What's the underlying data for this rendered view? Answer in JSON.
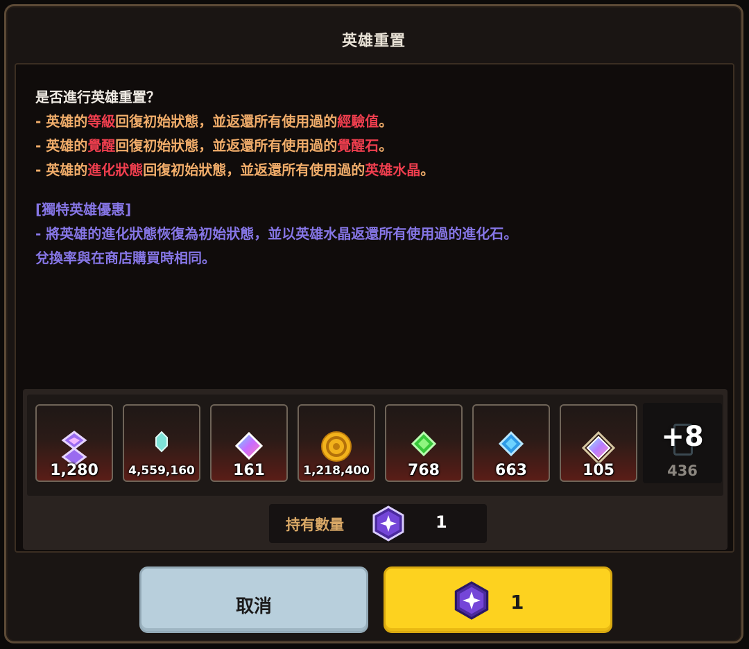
{
  "dialog": {
    "title": "英雄重置"
  },
  "description": {
    "question": "是否進行英雄重置？",
    "lines": [
      [
        {
          "t": "- 英雄的",
          "c": "o"
        },
        {
          "t": "等級",
          "c": "r"
        },
        {
          "t": "回復初始狀態，並返還所有使用過的",
          "c": "o"
        },
        {
          "t": "經驗值",
          "c": "r"
        },
        {
          "t": "。",
          "c": "o"
        }
      ],
      [
        {
          "t": "- 英雄的",
          "c": "o"
        },
        {
          "t": "覺醒",
          "c": "r"
        },
        {
          "t": "回復初始狀態，並返還所有使用過的",
          "c": "o"
        },
        {
          "t": "覺醒石",
          "c": "r"
        },
        {
          "t": "。",
          "c": "o"
        }
      ],
      [
        {
          "t": "- 英雄的",
          "c": "o"
        },
        {
          "t": "進化狀態",
          "c": "r"
        },
        {
          "t": "回復初始狀態，並返還所有使用過的",
          "c": "o"
        },
        {
          "t": "英雄水晶",
          "c": "r"
        },
        {
          "t": "。",
          "c": "o"
        }
      ]
    ],
    "bonus_title": "[獨特英雄優惠]",
    "bonus_lines": [
      "- 將英雄的進化狀態恢復為初始狀態，並以英雄水晶返還所有使用過的進化石。",
      "兌換率與在商店購買時相同。"
    ]
  },
  "rewards": {
    "items": [
      {
        "icon": "purple-sigil-icon",
        "quantity": "1,280"
      },
      {
        "icon": "cyan-crystal-icon",
        "quantity": "4,559,160"
      },
      {
        "icon": "rainbow-gem-icon",
        "quantity": "161"
      },
      {
        "icon": "gold-coin-icon",
        "quantity": "1,218,400"
      },
      {
        "icon": "green-gem-icon",
        "quantity": "768"
      },
      {
        "icon": "blue-gem-icon",
        "quantity": "663"
      },
      {
        "icon": "prism-stone-icon",
        "quantity": "105"
      }
    ],
    "more": {
      "label": "+8",
      "quantity": "436"
    }
  },
  "owned": {
    "label": "持有數量",
    "value": "1",
    "icon": "hero-crystal-icon"
  },
  "buttons": {
    "cancel_label": "取消",
    "confirm_value": "1",
    "confirm_icon": "hero-crystal-icon"
  },
  "colors": {
    "normal_text": "#f1ad6a",
    "highlight_text": "#ef3e4e",
    "bonus_text": "#8676e6",
    "confirm_button": "#fdd21f",
    "cancel_button": "#b8cfdc"
  }
}
